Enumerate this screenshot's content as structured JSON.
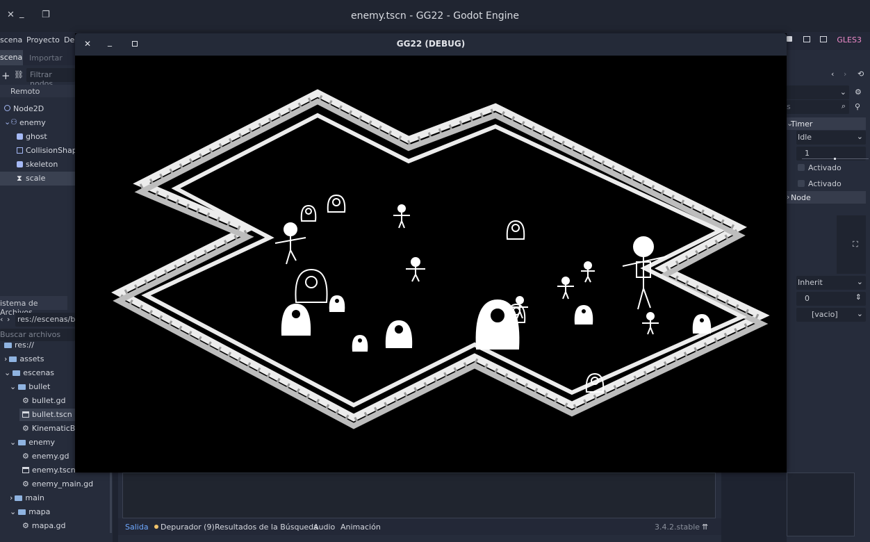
{
  "main_window": {
    "title": "enemy.tscn - GG22 - Godot Engine",
    "menu": [
      "scena",
      "Proyecto",
      "Dep"
    ],
    "renderer": "GLES3"
  },
  "scene_dock": {
    "tabs": [
      "scena",
      "Importar"
    ],
    "filter_placeholder": "Filtrar nodos",
    "remote_label": "Remoto",
    "tree": [
      {
        "label": "Node2D",
        "icon": "node2d-icon"
      },
      {
        "label": "enemy",
        "icon": "kinematic-icon"
      },
      {
        "label": "ghost",
        "icon": "animated-sprite-icon"
      },
      {
        "label": "CollisionShape",
        "icon": "collision-icon"
      },
      {
        "label": "skeleton",
        "icon": "animated-sprite-icon"
      },
      {
        "label": "scale",
        "icon": "timer-icon"
      }
    ]
  },
  "filesystem_dock": {
    "title": "istema de Archivos",
    "path": "res://escenas/bu",
    "search_placeholder": "Buscar archivos",
    "items": [
      {
        "label": "res://",
        "type": "root"
      },
      {
        "label": "assets",
        "type": "folder"
      },
      {
        "label": "escenas",
        "type": "folder"
      },
      {
        "label": "bullet",
        "type": "folder"
      },
      {
        "label": "bullet.gd",
        "type": "script"
      },
      {
        "label": "bullet.tscn",
        "type": "scene"
      },
      {
        "label": "KinematicBo",
        "type": "script"
      },
      {
        "label": "enemy",
        "type": "folder"
      },
      {
        "label": "enemy.gd",
        "type": "script"
      },
      {
        "label": "enemy.tscn",
        "type": "scene"
      },
      {
        "label": "enemy_main.gd",
        "type": "script"
      },
      {
        "label": "main",
        "type": "folder"
      },
      {
        "label": "mapa",
        "type": "folder"
      },
      {
        "label": "mapa.gd",
        "type": "script"
      }
    ]
  },
  "inspector": {
    "search_placeholder": "s",
    "node_type": "Timer",
    "process_mode": "Idle",
    "wait_time": "1",
    "check1": "Activado",
    "check2": "Activado",
    "section": "Node",
    "pause_mode": "Inherit",
    "number": "0",
    "script": "[vacio]"
  },
  "bottom_panel": {
    "tabs": [
      "Salida",
      "Depurador (9)",
      "Resultados de la Búsqueda",
      "Audio",
      "Animación"
    ],
    "version": "3.4.2.stable"
  },
  "debug_window": {
    "title": "GG22 (DEBUG)"
  }
}
